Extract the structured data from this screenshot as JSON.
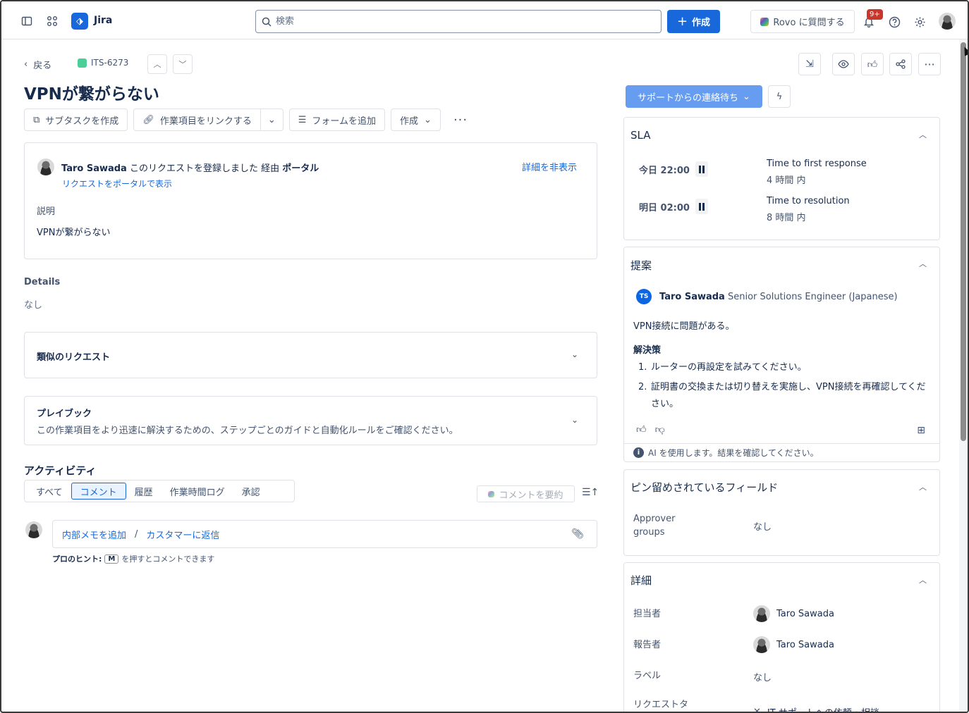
{
  "app": {
    "name": "Jira",
    "logo_glyph": "⬗"
  },
  "topnav": {
    "search_placeholder": "検索",
    "create_label": "作成",
    "rovo_label": "Rovo に質問する",
    "notif_count": "9+"
  },
  "issue": {
    "back_label": "戻る",
    "key": "ITS-6273",
    "title": "VPNが繋がらない",
    "actions": {
      "subtask": "サブタスクを作成",
      "link": "作業項目をリンクする",
      "form": "フォームを追加",
      "create": "作成"
    }
  },
  "request": {
    "reporter": "Taro Sawada",
    "registered_text": "このリクエストを登録しました",
    "via_label": "経由",
    "channel": "ポータル",
    "portal_link": "リクエストをポータルで表示",
    "hide_details": "詳細を非表示",
    "description_label": "説明",
    "description": "VPNが繋がらない"
  },
  "details": {
    "heading": "Details",
    "value": "なし"
  },
  "similar": {
    "title": "類似のリクエスト"
  },
  "playbook": {
    "title": "プレイブック",
    "subtitle": "この作業項目をより迅速に解決するための、ステップごとのガイドと自動化ルールをご確認ください。"
  },
  "activity": {
    "heading": "アクティビティ",
    "tabs": [
      "すべて",
      "コメント",
      "履歴",
      "作業時間ログ",
      "承認"
    ],
    "active_tab": "コメント",
    "summarize_label": "コメントを要約",
    "internal_note": "内部メモを追加",
    "separator": "/",
    "reply_customer": "カスタマーに返信",
    "hint_prefix": "プロのヒント:",
    "hint_key": "M",
    "hint_suffix": "を押すとコメントできます"
  },
  "status": {
    "label": "サポートからの連絡待ち"
  },
  "sla": {
    "heading": "SLA",
    "items": [
      {
        "time": "今日 22:00",
        "name": "Time to first response",
        "remaining": "4 時間 内"
      },
      {
        "time": "明日 02:00",
        "name": "Time to resolution",
        "remaining": "8 時間 内"
      }
    ]
  },
  "suggestion": {
    "heading": "提案",
    "initials": "TS",
    "author": "Taro Sawada",
    "role": "Senior Solutions Engineer (Japanese)",
    "text": "VPN接続に問題がある。",
    "solution_heading": "解決策",
    "steps": [
      {
        "num": "1.",
        "text": "ルーターの再設定を試みてください。"
      },
      {
        "num": "2.",
        "text": "証明書の交換または切り替えを実施し、VPN接続を再確認してください。"
      }
    ],
    "ai_note": "AI を使用します。結果を確認してください。"
  },
  "pinned": {
    "heading": "ピン留めされているフィールド",
    "label": "Approver groups",
    "value": "なし"
  },
  "detail_panel": {
    "heading": "詳細",
    "assignee_label": "担当者",
    "assignee": "Taro Sawada",
    "reporter_label": "報告者",
    "reporter": "Taro Sawada",
    "labels_label": "ラベル",
    "labels_value": "なし",
    "request_type_label": "リクエストタ",
    "request_type_value": "IT サポートへの依頼・相談"
  },
  "colors": {
    "accent": "#1868db",
    "status": "#669df1",
    "issue_type": "#4bce97",
    "badge": "#c9372c"
  }
}
